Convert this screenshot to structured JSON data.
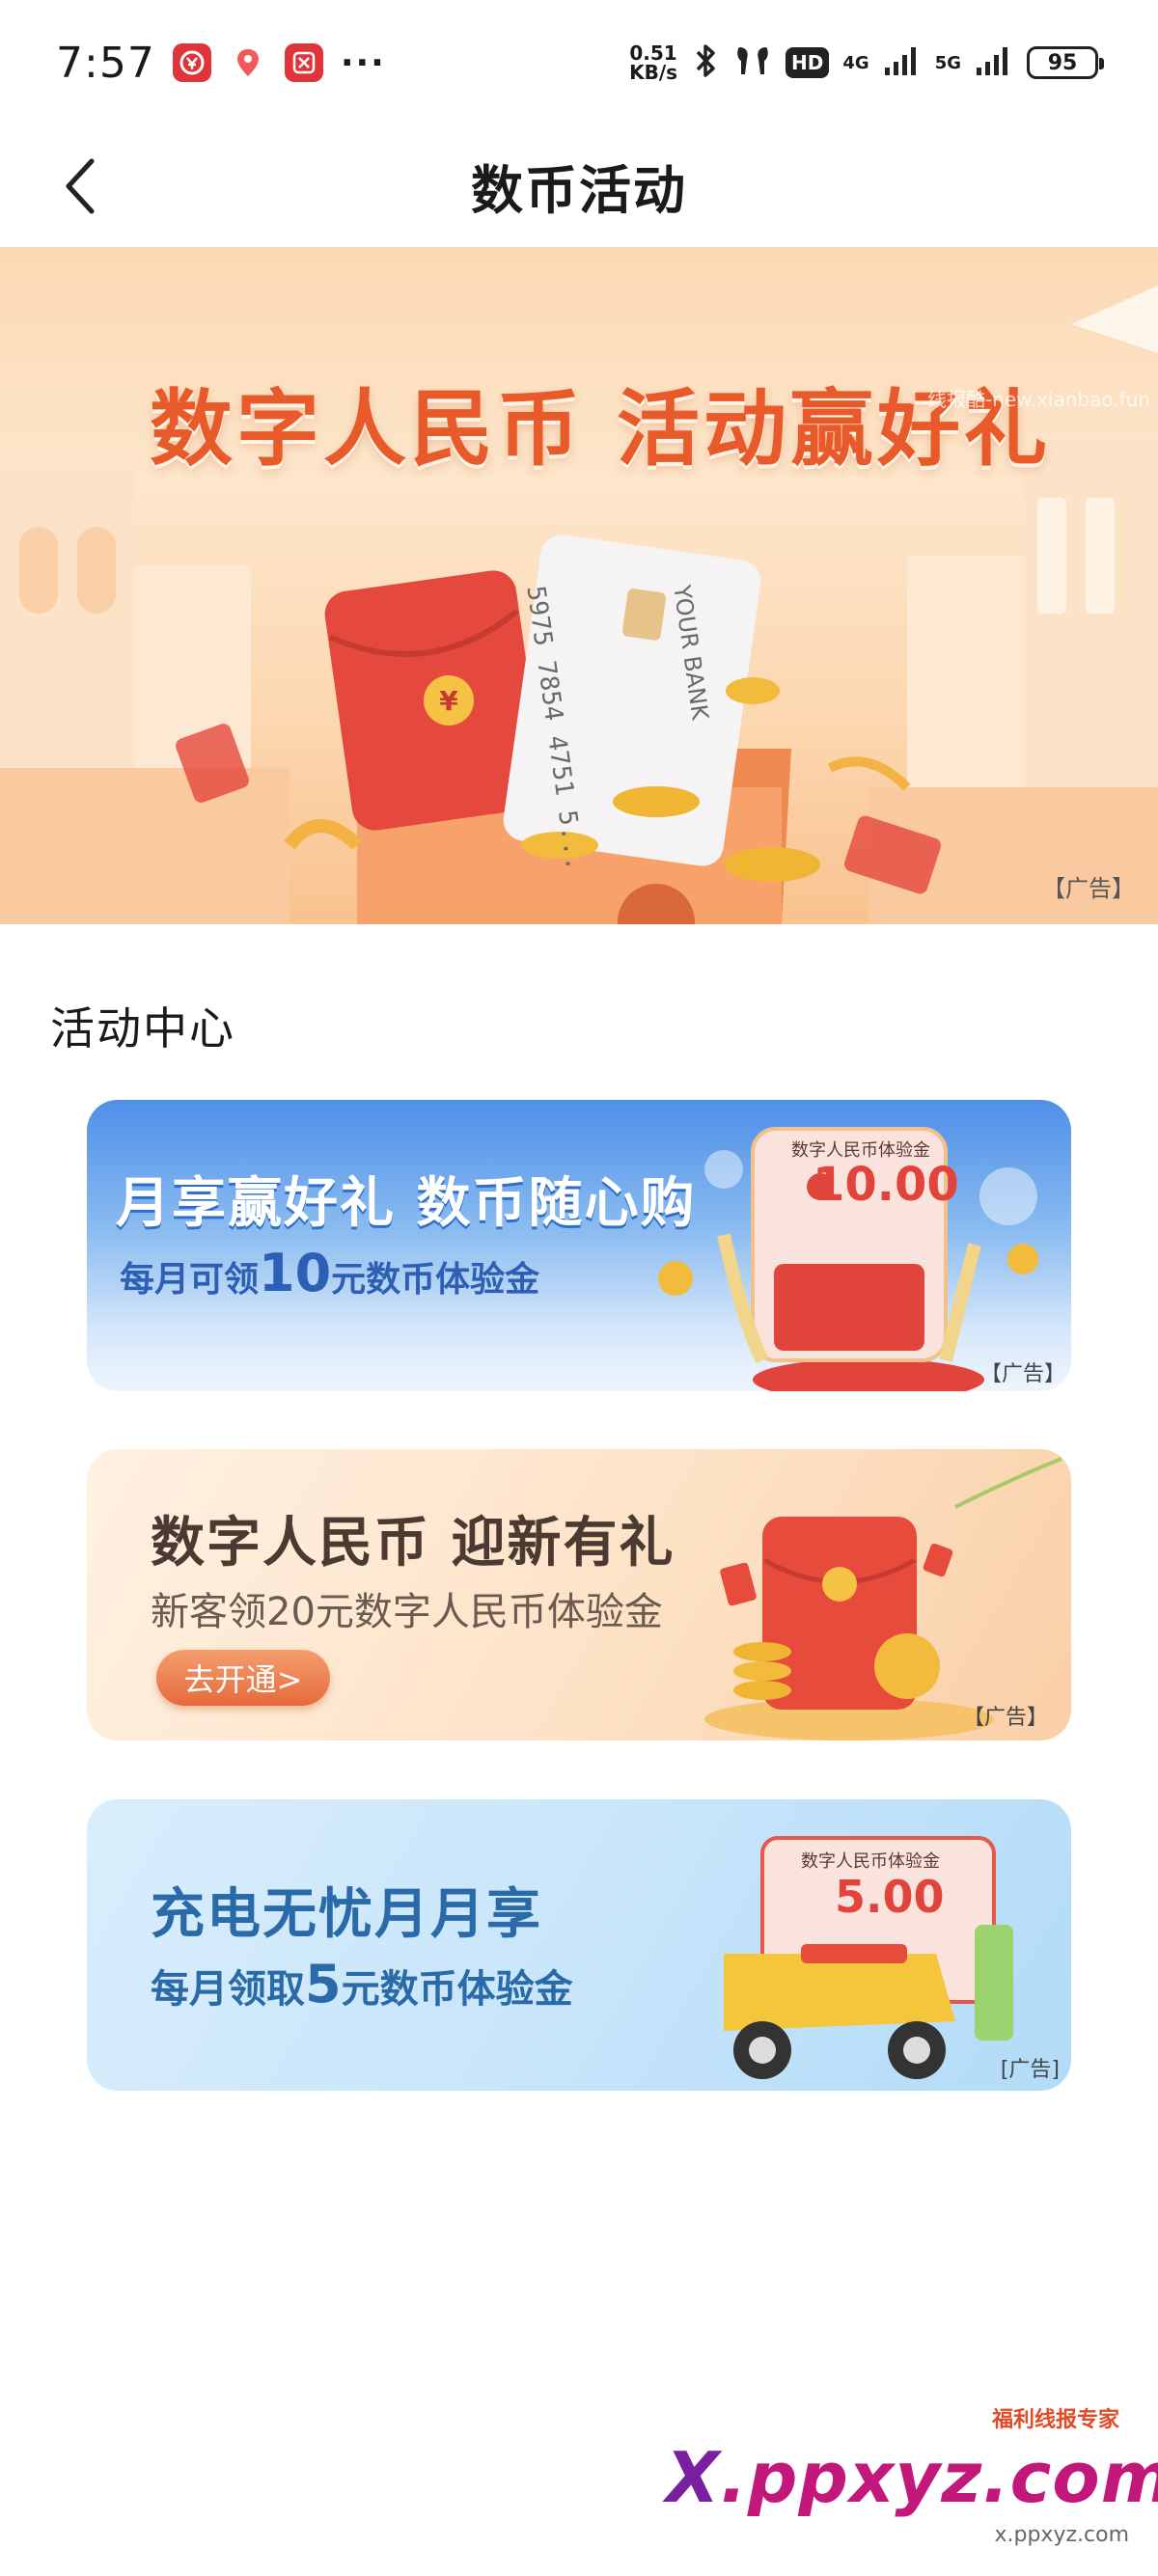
{
  "status_bar": {
    "time": "7:57",
    "speed_value": "0.51",
    "speed_unit": "KB/s",
    "hd_label": "HD",
    "net_4g": "4G",
    "net_5g": "5G",
    "battery": "95"
  },
  "header": {
    "title": "数币活动"
  },
  "hero": {
    "title": "数字人民币 活动赢好礼",
    "card_number": "5975 7854 4751 5...",
    "card_bank": "YOUR BANK",
    "ad_tag": "【广告】",
    "watermark": "线报酷-new.xianbao.fun"
  },
  "section": {
    "title": "活动中心"
  },
  "cards": [
    {
      "title": "月享赢好礼 数币随心购",
      "sub_prefix": "每月可领",
      "sub_amount": "10",
      "sub_suffix": "元数币体验金",
      "badge_label": "数字人民币体验金",
      "badge_amount": "10.00",
      "ad_tag": "【广告】"
    },
    {
      "title": "数字人民币 迎新有礼",
      "subtitle": "新客领20元数字人民币体验金",
      "button": "去开通>",
      "ad_tag": "【广告】"
    },
    {
      "title": "充电无忧月月享",
      "sub_prefix": "每月领取",
      "sub_amount": "5",
      "sub_suffix": "元数币体验金",
      "badge_label": "数字人民币体验金",
      "badge_amount": "5.00",
      "ad_tag": "[广告]"
    }
  ],
  "footer": {
    "brand_x": "X",
    "brand_rest": ".ppxyz.com",
    "tag": "福利线报专家",
    "small": "x.ppxyz.com"
  },
  "colors": {
    "hero_title": "#e85a2a",
    "card1_accent": "#2d5fb4",
    "card2_button": "#e66a3c",
    "card3_accent": "#2a6aa8"
  }
}
